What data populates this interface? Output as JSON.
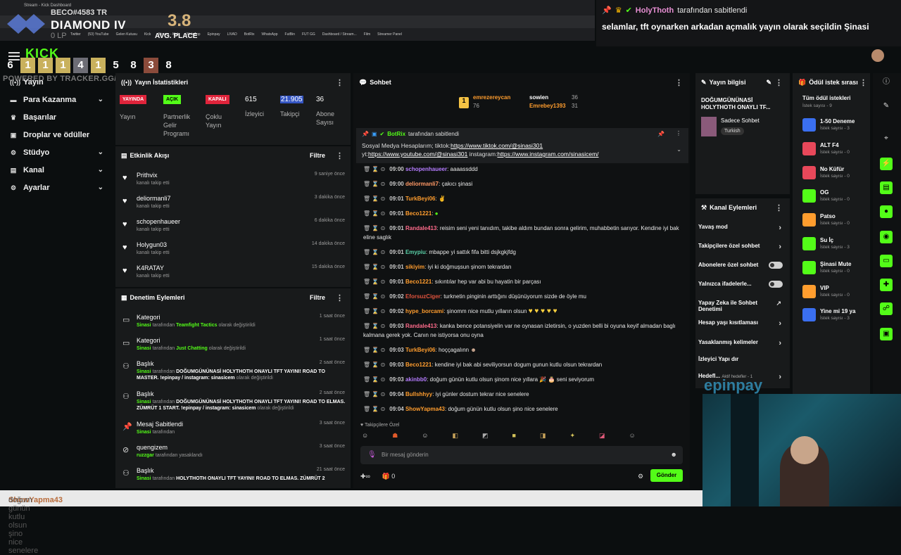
{
  "overlay": {
    "user": "BECO#4583 TR",
    "rank": "DIAMOND IV",
    "lp": "0 LP",
    "avg_value": "3.8",
    "avg_label": "AVG. PLACE",
    "placements": [
      "6",
      "1",
      "1",
      "1",
      "4",
      "1",
      "5",
      "8",
      "3",
      "8"
    ],
    "powered": "POWERED BY TRACKER.GG/TFT"
  },
  "browser": {
    "tab_title": "Stream - Kick Dashboard",
    "bookmarks": [
      "Twitter",
      "(53) YouTube",
      "Gelen Kutusu",
      "Kick",
      "Stream - Kick",
      "Web App",
      "Epinpay",
      "LIVAD",
      "BotRix",
      "WhatsApp",
      "FutBin",
      "FUT GG",
      "Dashboard / Stream...",
      "Film",
      "Streamer Panel"
    ]
  },
  "pinned_top": {
    "name": "HolyThoth",
    "suffix": "tarafından sabitlendi",
    "message": "selamlar, tft oynarken arkadan açmalık yayın olarak seçildin Şinasi"
  },
  "nav": {
    "items": [
      {
        "label": "Yayın",
        "icon": "broadcast-icon"
      },
      {
        "label": "Para Kazanma",
        "icon": "money-icon"
      },
      {
        "label": "Başarılar",
        "icon": "trophy-icon"
      },
      {
        "label": "Droplar ve ödüller",
        "icon": "gift-icon"
      },
      {
        "label": "Stüdyo",
        "icon": "studio-icon"
      },
      {
        "label": "Kanal",
        "icon": "channel-icon"
      },
      {
        "label": "Ayarlar",
        "icon": "settings-icon"
      }
    ]
  },
  "stats": {
    "title": "Yayın İstatistikleri",
    "live_badge": "YAYINDA",
    "live_label": "Yayın",
    "open_badge": "AÇIK",
    "open_label": "Partnerlik Gelir Programı",
    "closed_badge": "KAPALI",
    "closed_label": "Çoklu Yayın",
    "viewers": "615",
    "viewers_label": "İzleyici",
    "followers": "21.905",
    "followers_label": "Takipçi",
    "subs": "36",
    "subs_label": "Abone Sayısı"
  },
  "activity": {
    "title": "Etkinlik Akışı",
    "filter": "Filtre",
    "items": [
      {
        "name": "Prithvix",
        "sub": "kanalı takip etti",
        "time": "9 saniye önce"
      },
      {
        "name": "deliormanli7",
        "sub": "kanalı takip etti",
        "time": "3 dakika önce"
      },
      {
        "name": "schopenhaueer",
        "sub": "kanalı takip etti",
        "time": "6 dakika önce"
      },
      {
        "name": "Holygun03",
        "sub": "kanalı takip etti",
        "time": "14 dakika önce"
      },
      {
        "name": "K4RATAY",
        "sub": "kanalı takip etti",
        "time": "15 dakika önce"
      }
    ]
  },
  "moderation": {
    "title": "Denetim Eylemleri",
    "filter": "Filtre",
    "items": [
      {
        "title": "Kategori",
        "actor": "Sinasi",
        "mid": "tarafından",
        "value": "Teamfight Tactics",
        "end": "olarak değiştirildi",
        "time": "1 saat önce"
      },
      {
        "title": "Kategori",
        "actor": "Sinasi",
        "mid": "tarafından",
        "value": "Just Chatting",
        "end": "olarak değiştirildi",
        "time": "1 saat önce"
      },
      {
        "title": "Başlık",
        "actor": "Sinasi",
        "mid": "tarafından",
        "value": "DOĞUMGÜNÜNASİ HOLYTHOTH ONAYLI TFT YAYINI! ROAD TO MASTER. !epinpay / instagram: sinasicem",
        "end": "olarak değiştirildi",
        "time": "2 saat önce"
      },
      {
        "title": "Başlık",
        "actor": "Sinasi",
        "mid": "tarafından",
        "value": "DOĞUMGÜNÜNASİ HOLYTHOTH ONAYLI TFT YAYINI! ROAD TO ELMAS. ZÜMRÜT 1 START. !epinpay / instagram: sinasicem",
        "end": "olarak değiştirildi",
        "time": "2 saat önce"
      },
      {
        "title": "Mesaj Sabitlendi",
        "actor": "Sinasi",
        "mid": "tarafından",
        "value": "",
        "end": "",
        "time": "3 saat önce"
      },
      {
        "title": "quengizem",
        "actor": "ruzzgar",
        "mid": "tarafından yasaklandı",
        "value": "",
        "end": "",
        "time": "3 saat önce"
      },
      {
        "title": "Başlık",
        "actor": "Sinasi",
        "mid": "tarafından",
        "value": "HOLYTHOTH ONAYLI TFT YAYINI! ROAD TO ELMAS. ZÜMRÜT 2",
        "end": "",
        "time": "21 saat önce"
      }
    ]
  },
  "chat": {
    "title": "Sohbet",
    "top_gifters": [
      {
        "name": "emrezereycan",
        "count": "76"
      },
      {
        "name": "sowien",
        "count": "36"
      },
      {
        "name": "Emrebey1393",
        "count": "31"
      }
    ],
    "pinned_by": "BotRix",
    "pinned_suffix": "tarafından sabitlendi",
    "pinned_text1": "Sosyal Medya Hesaplarım; tiktok:",
    "pinned_link1": "https://www.tiktok.com/@sinasi301",
    "pinned_text2": "yt:",
    "pinned_link2": "https://www.youtube.com/@sinasi301",
    "pinned_text3": " instagram:",
    "pinned_link3": "https://www.instagram.com/sinasicem/",
    "messages": [
      {
        "time": "09:00",
        "user": "schopenhaueer",
        "color": "#b57cff",
        "text": ": aaaassddd"
      },
      {
        "time": "09:00",
        "user": "deliormanli7",
        "color": "#ff9966",
        "text": ": çakıcı şinasi"
      },
      {
        "time": "09:01",
        "user": "TurkBeyi06",
        "color": "#ff9d2e",
        "text": ":"
      },
      {
        "time": "09:01",
        "user": "Beco1221",
        "color": "#ff9d2e",
        "text": ":"
      },
      {
        "time": "09:01",
        "user": "Randale413",
        "color": "#ff6b8b",
        "text": ": reisim seni yeni tanıdım, takibe aldım bundan sonra gelirim, muhabbetin sarıyor. Kendine iyi bak eline saglık"
      },
      {
        "time": "09:01",
        "user": "Emypiu",
        "color": "#5ad1a8",
        "text": ": mbappe yi sattık fifa bitti dsjkgkjfdg"
      },
      {
        "time": "09:01",
        "user": "sikiyim",
        "color": "#ff9d2e",
        "text": ": iyi ki doğmuşsun şinom tekrardan"
      },
      {
        "time": "09:01",
        "user": "Beco1221",
        "color": "#ff9d2e",
        "text": ": sıkıntılar hep var abi bu hayatin bir parçası"
      },
      {
        "time": "09:02",
        "user": "EforsuzCiger",
        "color": "#e0533d",
        "text": ": turknetin pinginin arttığını düşünüyorum sizde de öyle mu"
      },
      {
        "time": "09:02",
        "user": "hype_borcami",
        "color": "#ff9d2e",
        "text": ": şinomm nice mutlu yılların olsun"
      },
      {
        "time": "09:03",
        "user": "Randale413",
        "color": "#ff6b8b",
        "text": ": kanka bence potansiyelin var ne oynasan izletirsin, o yuzden belli bi oyuna keyif almadan baglı kalmana gerek yok. Canın ne istiyorsa onu oyna"
      },
      {
        "time": "09:03",
        "user": "TurkBeyi06",
        "color": "#ff9d2e",
        "text": ": hoççagalınn"
      },
      {
        "time": "09:03",
        "user": "Beco1221",
        "color": "#ff9d2e",
        "text": ": kendine iyi bak abi seviliyorsun dogum gunun kutlu olsun tekrardan"
      },
      {
        "time": "09:03",
        "user": "akinbb0",
        "color": "#b57cff",
        "text": ": doğum günün kutlu olsun şinom nice yıllara 🎉 🎂 seni seviyorum"
      },
      {
        "time": "09:04",
        "user": "Bullshhyy",
        "color": "#ff9d2e",
        "text": ": iyi günler dostum tekrar nice senelere"
      },
      {
        "time": "09:04",
        "user": "ShowYapma43",
        "color": "#ff9d2e",
        "text": ": doğum günün kutlu olsun şino nice senelere"
      }
    ],
    "followers_only": "Takipçilere Özel",
    "input_placeholder": "Bir mesaj gönderin",
    "points": "0",
    "send": "Gönder"
  },
  "stream_info": {
    "title": "Yayın bilgisi",
    "stream_title": "DOĞUMGÜNÜNASİ HOLYTHOTH ONAYLI TF...",
    "category": "Sadece Sohbet",
    "tag": "Turkish"
  },
  "channel_actions": {
    "title": "Kanal Eylemleri",
    "items": [
      {
        "label": "Yavaş mod",
        "type": "arrow"
      },
      {
        "label": "Takipçilere özel sohbet",
        "type": "arrow"
      },
      {
        "label": "Abonelere özel sohbet",
        "type": "toggle"
      },
      {
        "label": "Yalnızca ifadelerle...",
        "type": "toggle"
      },
      {
        "label": "Yapay Zeka ile Sohbet Denetimi",
        "type": "link"
      },
      {
        "label": "Hesap yaşı kısıtlaması",
        "type": "arrow"
      },
      {
        "label": "Yasaklanmış kelimeler",
        "type": "arrow"
      },
      {
        "label": "İzleyici Yapı dır",
        "type": "none"
      },
      {
        "label": "Hedefl...",
        "type": "arrow",
        "extra": "Aktif hedefler - 1"
      }
    ]
  },
  "rewards": {
    "title": "Ödül istek sırası",
    "all": "Tüm ödül istekleri",
    "all_count": "İstek sayısı - 9",
    "items": [
      {
        "name": "1-50 Deneme",
        "count": "İstek sayısı - 3",
        "color": "#3a6ff0"
      },
      {
        "name": "ALT F4",
        "count": "İstek sayısı - 0",
        "color": "#e8485a"
      },
      {
        "name": "No Küfür",
        "count": "İstek sayısı - 0",
        "color": "#e8485a"
      },
      {
        "name": "OG",
        "count": "İstek sayısı - 0",
        "color": "#53fc18"
      },
      {
        "name": "Patso",
        "count": "İstek sayısı - 0",
        "color": "#ff9d2e"
      },
      {
        "name": "Su İç",
        "count": "İstek sayısı - 3",
        "color": "#53fc18"
      },
      {
        "name": "Şinasi Mute",
        "count": "İstek sayısı - 0",
        "color": "#53fc18"
      },
      {
        "name": "VIP",
        "count": "İstek sayısı - 0",
        "color": "#ff9d2e"
      },
      {
        "name": "Yine mi 19 ya",
        "count": "İstek sayısı - 3",
        "color": "#3a6ff0"
      }
    ]
  },
  "ticker": {
    "name": "ShowYapma43",
    "text": " doğum günün kutlu olsun şino nice senelere"
  },
  "brand_watermark": "epinpay"
}
